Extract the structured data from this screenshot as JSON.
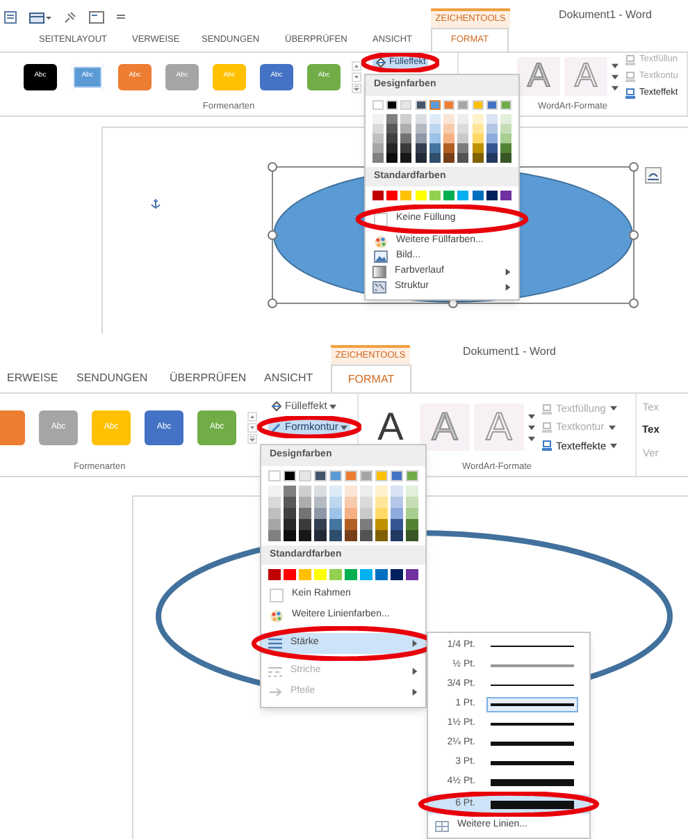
{
  "screens": [
    {
      "title_bar": {
        "context_label": "ZEICHENTOOLS",
        "title": "Dokument1 - Word"
      },
      "tabs": [
        {
          "label": "SEITENLAYOUT",
          "selected": false
        },
        {
          "label": "VERWEISE",
          "selected": false
        },
        {
          "label": "SENDUNGEN",
          "selected": false
        },
        {
          "label": "ÜBERPRÜFEN",
          "selected": false
        },
        {
          "label": "ANSICHT",
          "selected": false
        },
        {
          "label": "FORMAT",
          "selected": true
        }
      ],
      "shape_styles": [
        {
          "label": "Abc",
          "color": "#000000",
          "selected": false
        },
        {
          "label": "Abc",
          "color": "#5b9bd5",
          "selected": true
        },
        {
          "label": "Abc",
          "color": "#ed7d31",
          "selected": false
        },
        {
          "label": "Abc",
          "color": "#a5a5a5",
          "selected": false
        },
        {
          "label": "Abc",
          "color": "#ffc000",
          "selected": false
        },
        {
          "label": "Abc",
          "color": "#4472c4",
          "selected": false
        },
        {
          "label": "Abc",
          "color": "#70ad47",
          "selected": false
        }
      ],
      "shape_commands": [
        {
          "label": "Fülleffekt",
          "active": true,
          "circled": true,
          "dropdown": false
        }
      ],
      "wordart_styles": [
        {
          "label": "A",
          "kind": "light"
        },
        {
          "label": "A",
          "kind": "outline"
        }
      ],
      "text_commands": [
        {
          "label": "Textfüllun",
          "disabled": true
        },
        {
          "label": "Textkontu",
          "disabled": true
        },
        {
          "label": "Texteffekt",
          "disabled": false
        }
      ],
      "group_labels": [
        "Formenarten",
        "WordArt-Formate"
      ],
      "shape": {
        "kind": "filled",
        "selected": true
      },
      "menu": {
        "items": [
          {
            "kind": "header",
            "label": "Designfarben"
          },
          {
            "kind": "theme_colors",
            "colors": [
              {
                "color": "#ffffff",
                "selected": false
              },
              {
                "color": "#000000",
                "selected": false
              },
              {
                "color": "#e7e6e6",
                "selected": false
              },
              {
                "color": "#44546a",
                "selected": false
              },
              {
                "color": "#5b9bd5",
                "selected": true
              },
              {
                "color": "#ed7d31",
                "selected": false
              },
              {
                "color": "#a5a5a5",
                "selected": false
              },
              {
                "color": "#ffc000",
                "selected": false
              },
              {
                "color": "#4472c4",
                "selected": false
              },
              {
                "color": "#70ad47",
                "selected": false
              }
            ]
          },
          {
            "kind": "header",
            "label": "Standardfarben"
          },
          {
            "kind": "standard_colors",
            "colors": [
              {
                "color": "#c00000"
              },
              {
                "color": "#ff0000"
              },
              {
                "color": "#ffc000"
              },
              {
                "color": "#ffff00"
              },
              {
                "color": "#92d050"
              },
              {
                "color": "#00b050"
              },
              {
                "color": "#00b0f0"
              },
              {
                "color": "#0070c0"
              },
              {
                "color": "#002060"
              },
              {
                "color": "#7030a0"
              }
            ]
          },
          {
            "kind": "command",
            "label": "Keine Füllung",
            "circled": true,
            "highlighted": false,
            "disabled": false,
            "submenu": false
          },
          {
            "kind": "command",
            "label": "Weitere Füllfarben...",
            "circled": false,
            "highlighted": false,
            "disabled": false,
            "submenu": false
          },
          {
            "kind": "command",
            "label": "Bild...",
            "circled": false,
            "highlighted": false,
            "disabled": false,
            "submenu": false
          },
          {
            "kind": "command",
            "label": "Farbverlauf",
            "circled": false,
            "highlighted": false,
            "disabled": false,
            "submenu": true
          },
          {
            "kind": "command",
            "label": "Struktur",
            "circled": false,
            "highlighted": false,
            "disabled": false,
            "submenu": true
          }
        ]
      }
    },
    {
      "title_bar": {
        "context_label": "ZEICHENTOOLS",
        "title": "Dokument1 - Word"
      },
      "tabs": [
        {
          "label": "ERWEISE",
          "selected": false
        },
        {
          "label": "SENDUNGEN",
          "selected": false
        },
        {
          "label": "ÜBERPRÜFEN",
          "selected": false
        },
        {
          "label": "ANSICHT",
          "selected": false
        },
        {
          "label": "FORMAT",
          "selected": true
        }
      ],
      "shape_styles": [
        {
          "color": "#ed7d31",
          "selected": false
        },
        {
          "label": "Abc",
          "color": "#a5a5a5",
          "selected": false
        },
        {
          "label": "Abc",
          "color": "#ffc000",
          "selected": false
        },
        {
          "label": "Abc",
          "color": "#4472c4",
          "selected": false
        },
        {
          "label": "Abc",
          "color": "#70ad47",
          "selected": false
        }
      ],
      "shape_commands": [
        {
          "label": "Fülleffekt",
          "active": false,
          "circled": false,
          "dropdown": true
        },
        {
          "label": "Formkontur",
          "active": true,
          "circled": true,
          "dropdown": true
        }
      ],
      "wordart_styles": [
        {
          "label": "A",
          "kind": "dark"
        },
        {
          "label": "A",
          "kind": "light"
        },
        {
          "label": "A",
          "kind": "outline"
        }
      ],
      "text_commands": [
        {
          "label": "Textfüllung",
          "disabled": true
        },
        {
          "label": "Textkontur",
          "disabled": true
        },
        {
          "label": "Texteffekte",
          "disabled": false
        }
      ],
      "extra_commands": [
        {
          "label": "Tex",
          "disabled": true
        },
        {
          "label": "Tex",
          "disabled": false
        },
        {
          "label": "Ver",
          "disabled": true
        }
      ],
      "group_labels": [
        "Formenarten",
        "WordArt-Formate"
      ],
      "shape": {
        "kind": "outline",
        "selected": false
      },
      "menu": {
        "items": [
          {
            "kind": "header",
            "label": "Designfarben"
          },
          {
            "kind": "theme_colors",
            "colors": [
              {
                "color": "#ffffff",
                "selected": false
              },
              {
                "color": "#000000",
                "selected": false
              },
              {
                "color": "#e7e6e6",
                "selected": false
              },
              {
                "color": "#44546a",
                "selected": false
              },
              {
                "color": "#5b9bd5",
                "selected": false
              },
              {
                "color": "#ed7d31",
                "selected": false
              },
              {
                "color": "#a5a5a5",
                "selected": false
              },
              {
                "color": "#ffc000",
                "selected": false
              },
              {
                "color": "#4472c4",
                "selected": false
              },
              {
                "color": "#70ad47",
                "selected": false
              }
            ]
          },
          {
            "kind": "header",
            "label": "Standardfarben"
          },
          {
            "kind": "standard_colors",
            "colors": [
              {
                "color": "#c00000"
              },
              {
                "color": "#ff0000"
              },
              {
                "color": "#ffc000"
              },
              {
                "color": "#ffff00"
              },
              {
                "color": "#92d050"
              },
              {
                "color": "#00b050"
              },
              {
                "color": "#00b0f0"
              },
              {
                "color": "#0070c0"
              },
              {
                "color": "#002060"
              },
              {
                "color": "#7030a0"
              }
            ]
          },
          {
            "kind": "command",
            "label": "Kein Rahmen",
            "circled": false,
            "highlighted": false,
            "disabled": false,
            "submenu": false
          },
          {
            "kind": "command",
            "label": "Weitere Linienfarben...",
            "circled": false,
            "highlighted": false,
            "disabled": false,
            "submenu": false
          },
          {
            "kind": "command",
            "label": "Stärke",
            "circled": true,
            "highlighted": true,
            "disabled": false,
            "submenu": true
          },
          {
            "kind": "command",
            "label": "Striche",
            "circled": false,
            "highlighted": false,
            "disabled": true,
            "submenu": true
          },
          {
            "kind": "command",
            "label": "Pfeile",
            "circled": false,
            "highlighted": false,
            "disabled": true,
            "submenu": true
          }
        ]
      },
      "submenu": {
        "items": [
          {
            "kind": "weight",
            "label": "1/4 Pt.",
            "selected": false,
            "highlighted": false,
            "circled": false
          },
          {
            "kind": "weight",
            "label": "½ Pt.",
            "selected": false,
            "highlighted": false,
            "circled": false
          },
          {
            "kind": "weight",
            "label": "3/4 Pt.",
            "selected": false,
            "highlighted": false,
            "circled": false
          },
          {
            "kind": "weight",
            "label": "1 Pt.",
            "selected": true,
            "highlighted": false,
            "circled": false
          },
          {
            "kind": "weight",
            "label": "1½ Pt.",
            "selected": false,
            "highlighted": false,
            "circled": false
          },
          {
            "kind": "weight",
            "label": "2¼ Pt.",
            "selected": false,
            "highlighted": false,
            "circled": false
          },
          {
            "kind": "weight",
            "label": "3 Pt.",
            "selected": false,
            "highlighted": false,
            "circled": false
          },
          {
            "kind": "weight",
            "label": "4½ Pt.",
            "selected": false,
            "highlighted": false,
            "circled": false
          },
          {
            "kind": "weight",
            "label": "6 Pt.",
            "selected": false,
            "highlighted": true,
            "circled": true
          },
          {
            "kind": "command",
            "label": "Weitere Linien..."
          }
        ]
      }
    }
  ]
}
